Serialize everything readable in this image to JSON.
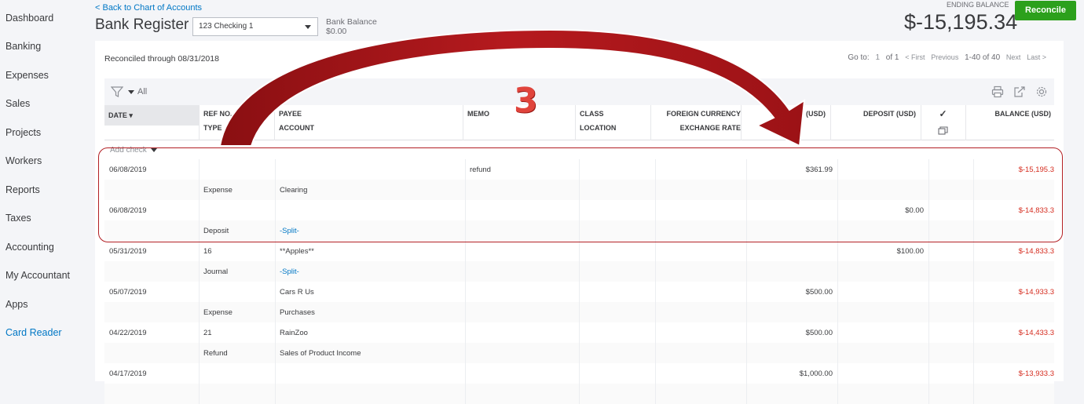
{
  "sidebar": {
    "items": [
      {
        "label": "Dashboard"
      },
      {
        "label": "Banking"
      },
      {
        "label": "Expenses"
      },
      {
        "label": "Sales"
      },
      {
        "label": "Projects"
      },
      {
        "label": "Workers"
      },
      {
        "label": "Reports"
      },
      {
        "label": "Taxes"
      },
      {
        "label": "Accounting"
      },
      {
        "label": "My Accountant"
      },
      {
        "label": "Apps"
      },
      {
        "label": "Card Reader"
      }
    ]
  },
  "header": {
    "back_link": "< Back to Chart of Accounts",
    "title": "Bank Register",
    "account_select": "123 Checking 1",
    "bank_balance_label": "Bank Balance",
    "bank_balance_value": "$0.00",
    "ending_balance_label": "ENDING BALANCE",
    "ending_balance_value": "$-15,195.34",
    "reconcile_button": "Reconcile"
  },
  "panel": {
    "reconciled_through": "Reconciled through 08/31/2018",
    "pager": {
      "goto_label": "Go to:",
      "page": "1",
      "of": "of 1",
      "first": "< First",
      "previous": "Previous",
      "range": "1-40 of 40",
      "next": "Next",
      "last": "Last >"
    },
    "filter_label": "All",
    "add_check": "Add check"
  },
  "columns": {
    "date": "DATE",
    "ref_no": "REF NO.",
    "type": "TYPE",
    "payee": "PAYEE",
    "account": "ACCOUNT",
    "memo": "MEMO",
    "class": "CLASS",
    "location": "LOCATION",
    "foreign_currency": "FOREIGN CURRENCY",
    "exchange_rate": "EXCHANGE RATE",
    "payment": "PAYMENT (USD)",
    "deposit": "DEPOSIT (USD)",
    "reconciled": "✓",
    "balance": "BALANCE (USD)"
  },
  "rows": [
    {
      "date": "06/08/2019",
      "ref": "",
      "type": "Expense",
      "payee": "",
      "account": "Clearing",
      "memo": "refund",
      "payment": "$361.99",
      "deposit": "",
      "balance": "$-15,195.3"
    },
    {
      "date": "06/08/2019",
      "ref": "",
      "type": "Deposit",
      "payee": "",
      "account": "-Split-",
      "memo": "",
      "payment": "",
      "deposit": "$0.00",
      "balance": "$-14,833.3"
    },
    {
      "date": "05/31/2019",
      "ref": "16",
      "type": "Journal",
      "payee": "**Apples**",
      "account": "-Split-",
      "memo": "",
      "payment": "",
      "deposit": "$100.00",
      "balance": "$-14,833.3"
    },
    {
      "date": "05/07/2019",
      "ref": "",
      "type": "Expense",
      "payee": "Cars R Us",
      "account": "Purchases",
      "memo": "",
      "payment": "$500.00",
      "deposit": "",
      "balance": "$-14,933.3"
    },
    {
      "date": "04/22/2019",
      "ref": "21",
      "type": "Refund",
      "payee": "RainZoo",
      "account": "Sales of Product Income",
      "memo": "",
      "payment": "$500.00",
      "deposit": "",
      "balance": "$-14,433.3"
    },
    {
      "date": "04/17/2019",
      "ref": "",
      "type": "",
      "payee": "",
      "account": "",
      "memo": "",
      "payment": "$1,000.00",
      "deposit": "",
      "balance": "$-13,933.3"
    }
  ],
  "annotation": {
    "number": "3",
    "color": "#b21f24"
  }
}
